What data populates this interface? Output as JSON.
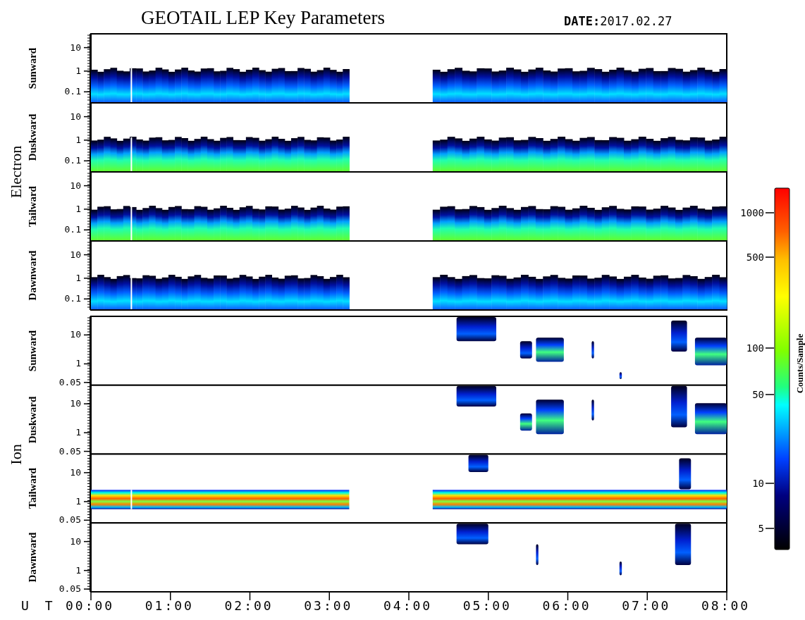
{
  "title": "GEOTAIL LEP Key Parameters",
  "date": "**DATE:**2017.02.27",
  "groups": [
    {
      "kind": "electron",
      "name": "Electron",
      "panels": [
        {
          "label": "Sunward",
          "yticks": [
            "10",
            "1",
            "0.1"
          ]
        },
        {
          "label": "Duskward",
          "yticks": [
            "10",
            "1",
            "0.1"
          ]
        },
        {
          "label": "Tailward",
          "yticks": [
            "10",
            "1",
            "0.1"
          ]
        },
        {
          "label": "Dawnward",
          "yticks": [
            "10",
            "1",
            "0.1"
          ]
        }
      ]
    },
    {
      "kind": "ion",
      "name": "Ion",
      "panels": [
        {
          "label": "Sunward",
          "yticks": [
            "10",
            "1",
            "0.05"
          ]
        },
        {
          "label": "Duskward",
          "yticks": [
            "10",
            "1",
            "0.05"
          ]
        },
        {
          "label": "Tailward",
          "yticks": [
            "10",
            "1",
            "0.05"
          ]
        },
        {
          "label": "Dawnward",
          "yticks": [
            "10",
            "1",
            "0.05"
          ]
        }
      ]
    }
  ],
  "x_axis": {
    "label": "U T",
    "ticks": [
      "00:00",
      "01:00",
      "02:00",
      "03:00",
      "04:00",
      "05:00",
      "06:00",
      "07:00",
      "08:00"
    ]
  },
  "colorbar": {
    "title": "Counts/Sample",
    "ticks": [
      "1000",
      "500",
      "100",
      "50",
      "10",
      "5"
    ]
  }
}
